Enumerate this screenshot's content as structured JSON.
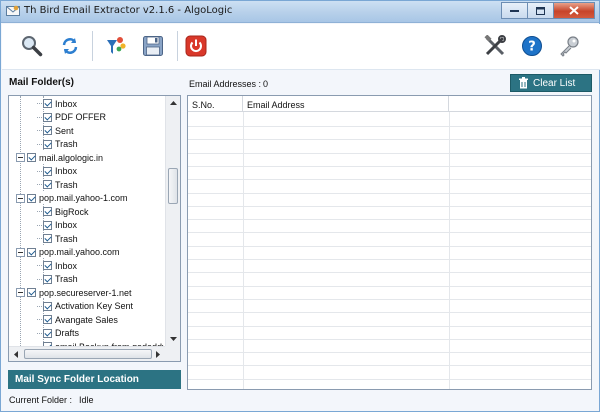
{
  "window": {
    "title": "Th Bird Email Extractor v2.1.6 - AlgoLogic",
    "icon": "app-envelope-icon"
  },
  "toolbar": {
    "left_buttons": [
      {
        "icon": "magnifier-search-icon"
      },
      {
        "icon": "refresh-icon"
      },
      {
        "icon": "filter-funnel-icon"
      },
      {
        "icon": "save-floppy-icon"
      },
      {
        "icon": "power-exit-icon",
        "color": "#d9382a"
      }
    ],
    "right_buttons": [
      {
        "icon": "tools-settings-icon"
      },
      {
        "icon": "help-icon",
        "color": "#1e73c8"
      },
      {
        "icon": "key-license-icon"
      }
    ]
  },
  "mail_folders": {
    "title": "Mail Folder(s)",
    "items": [
      {
        "label": "Inbox",
        "level": 1,
        "checked": true
      },
      {
        "label": "PDF OFFER",
        "level": 1,
        "checked": true
      },
      {
        "label": "Sent",
        "level": 1,
        "checked": true
      },
      {
        "label": "Trash",
        "level": 1,
        "checked": true
      },
      {
        "label": "mail.algologic.in",
        "level": 0,
        "checked": true,
        "expanded": true
      },
      {
        "label": "Inbox",
        "level": 1,
        "checked": true
      },
      {
        "label": "Trash",
        "level": 1,
        "checked": true
      },
      {
        "label": "pop.mail.yahoo-1.com",
        "level": 0,
        "checked": true,
        "expanded": true
      },
      {
        "label": "BigRock",
        "level": 1,
        "checked": true
      },
      {
        "label": "Inbox",
        "level": 1,
        "checked": true
      },
      {
        "label": "Trash",
        "level": 1,
        "checked": true
      },
      {
        "label": "pop.mail.yahoo.com",
        "level": 0,
        "checked": true,
        "expanded": true
      },
      {
        "label": "Inbox",
        "level": 1,
        "checked": true
      },
      {
        "label": "Trash",
        "level": 1,
        "checked": true
      },
      {
        "label": "pop.secureserver-1.net",
        "level": 0,
        "checked": true,
        "expanded": true
      },
      {
        "label": "Activation Key Sent",
        "level": 1,
        "checked": true
      },
      {
        "label": "Avangate Sales",
        "level": 1,
        "checked": true
      },
      {
        "label": "Drafts",
        "level": 1,
        "checked": true
      },
      {
        "label": "email Backup from godaddy",
        "level": 1,
        "checked": true
      }
    ],
    "sync_location_label": "Mail Sync Folder Location"
  },
  "emails": {
    "count_label": "Email Addresses :",
    "count_value": "0",
    "clear_label": "Clear List",
    "columns": [
      "S.No.",
      "Email Address"
    ],
    "rows": []
  },
  "status": {
    "label": "Current Folder :",
    "value": "Idle"
  },
  "colors": {
    "accent": "#2c7383",
    "titlebar": "#b7d0ea"
  }
}
